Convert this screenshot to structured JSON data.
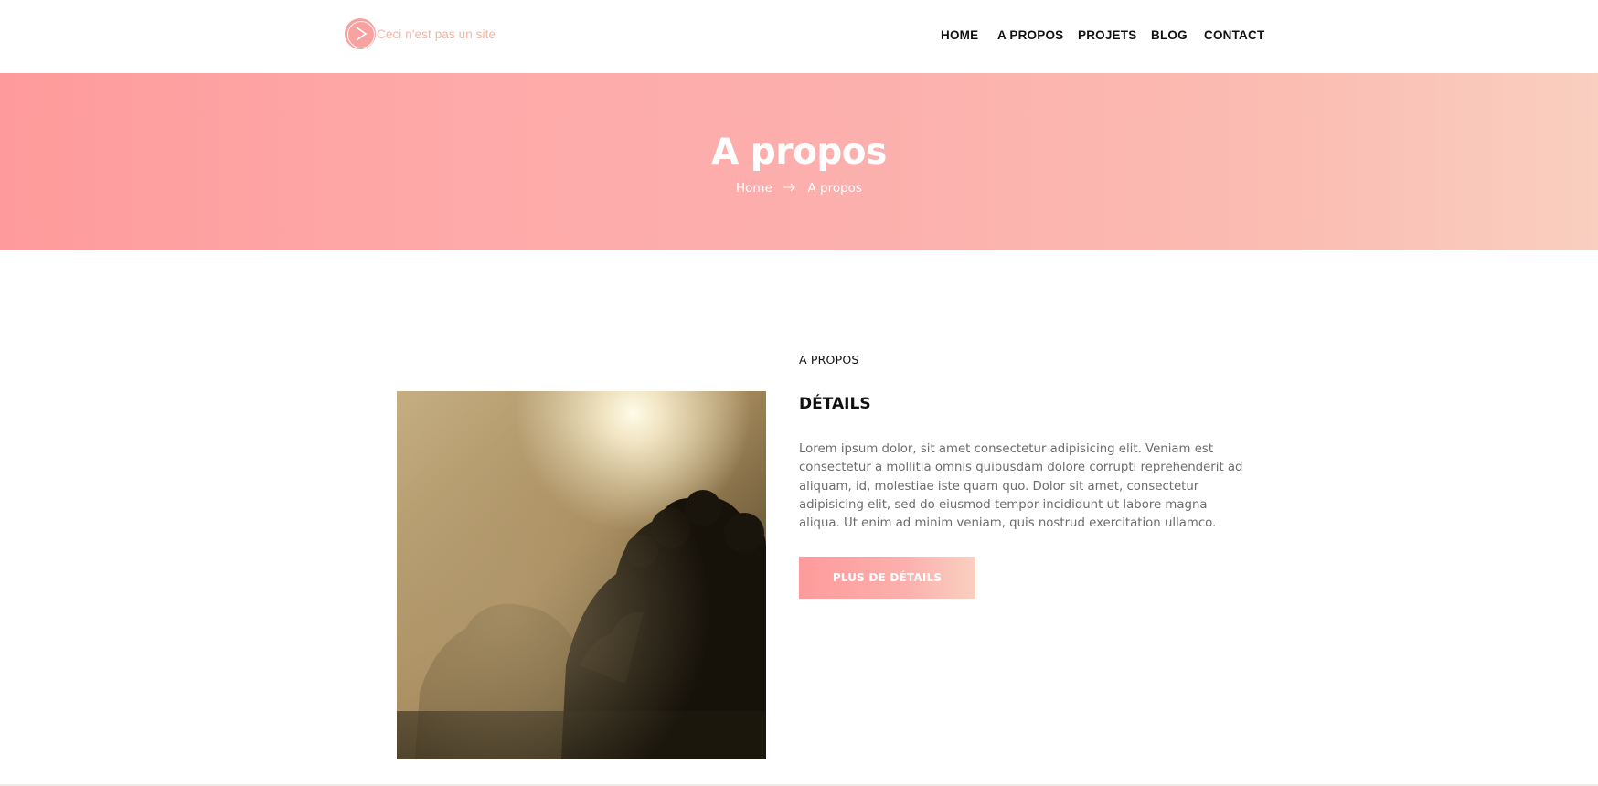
{
  "header": {
    "logo_icon": "play-circle-icon",
    "logo_text": "Ceci n'est pas un site",
    "nav": {
      "home": "HOME",
      "about": "A PROPOS",
      "projects": "PROJETS",
      "blog": "BLOG",
      "contact": "CONTACT"
    }
  },
  "banner": {
    "title": "A propos",
    "breadcrumb": {
      "home": "Home",
      "separator_icon": "arrow-right-icon",
      "current": "A propos"
    }
  },
  "about": {
    "label": "A PROPOS",
    "heading": "DÉTAILS",
    "body": "Lorem ipsum dolor, sit amet consectetur adipisicing elit. Veniam est consectetur a mollitia omnis quibusdam dolore corrupti reprehenderit ad aliquam, id, molestiae iste quam quo. Dolor sit amet, consectetur adipisicing elit, sed do eiusmod tempor incididunt ut labore magna aliqua. Ut enim ad minim veniam, quis nostrud exercitation ullamco.",
    "button": "PLUS DE DÉTAILS"
  },
  "colors": {
    "accent_start": "#fe9a9b",
    "accent_end": "#f9cfc0",
    "logo_text": "#f6b3a1"
  }
}
